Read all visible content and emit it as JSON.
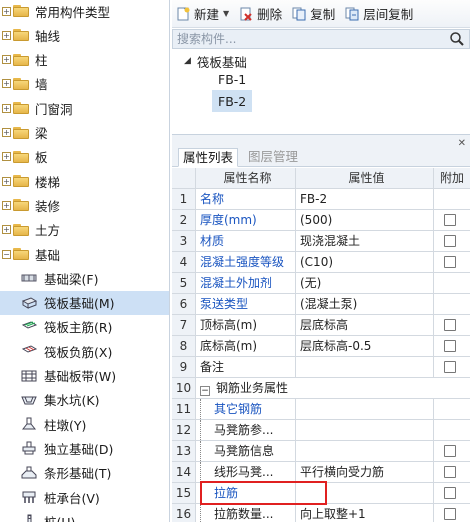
{
  "tree": {
    "categories": [
      {
        "label": "常用构件类型",
        "expanded": false
      },
      {
        "label": "轴线",
        "expanded": false
      },
      {
        "label": "柱",
        "expanded": false
      },
      {
        "label": "墙",
        "expanded": false
      },
      {
        "label": "门窗洞",
        "expanded": false
      },
      {
        "label": "梁",
        "expanded": false
      },
      {
        "label": "板",
        "expanded": false
      },
      {
        "label": "楼梯",
        "expanded": false
      },
      {
        "label": "装修",
        "expanded": false
      },
      {
        "label": "土方",
        "expanded": false
      },
      {
        "label": "基础",
        "expanded": true
      }
    ],
    "children": [
      {
        "label": "基础梁(F)",
        "icon": "foundation-beam-icon",
        "selected": false
      },
      {
        "label": "筏板基础(M)",
        "icon": "raft-foundation-icon",
        "selected": true
      },
      {
        "label": "筏板主筋(R)",
        "icon": "raft-main-rebar-icon",
        "selected": false
      },
      {
        "label": "筏板负筋(X)",
        "icon": "raft-negative-rebar-icon",
        "selected": false
      },
      {
        "label": "基础板带(W)",
        "icon": "foundation-strip-icon",
        "selected": false
      },
      {
        "label": "集水坑(K)",
        "icon": "sump-pit-icon",
        "selected": false
      },
      {
        "label": "柱墩(Y)",
        "icon": "column-pier-icon",
        "selected": false
      },
      {
        "label": "独立基础(D)",
        "icon": "isolated-footing-icon",
        "selected": false
      },
      {
        "label": "条形基础(T)",
        "icon": "strip-footing-icon",
        "selected": false
      },
      {
        "label": "桩承台(V)",
        "icon": "pile-cap-icon",
        "selected": false
      },
      {
        "label": "桩(U)",
        "icon": "pile-icon",
        "selected": false
      }
    ]
  },
  "toolbar": {
    "new_label": "新建",
    "delete_label": "删除",
    "copy_label": "复制",
    "floor_copy_label": "层间复制"
  },
  "search": {
    "placeholder": "搜索构件..."
  },
  "component_tree": {
    "group_label": "筏板基础",
    "items": [
      "FB-1",
      "FB-2"
    ],
    "selected": "FB-2"
  },
  "properties": {
    "tabs": [
      {
        "label": "属性列表",
        "active": true
      },
      {
        "label": "图层管理",
        "active": false
      }
    ],
    "headers": {
      "name": "属性名称",
      "value": "属性值",
      "add": "附加"
    },
    "rows": [
      {
        "num": "1",
        "name": "名称",
        "value": "FB-2",
        "blue": true,
        "check": false
      },
      {
        "num": "2",
        "name": "厚度(mm)",
        "value": "(500)",
        "blue": true,
        "check": true
      },
      {
        "num": "3",
        "name": "材质",
        "value": "现浇混凝土",
        "blue": true,
        "check": true
      },
      {
        "num": "4",
        "name": "混凝土强度等级",
        "value": "(C10)",
        "blue": true,
        "check": true
      },
      {
        "num": "5",
        "name": "混凝土外加剂",
        "value": "(无)",
        "blue": true,
        "check": false
      },
      {
        "num": "6",
        "name": "泵送类型",
        "value": "(混凝土泵)",
        "blue": true,
        "check": false
      },
      {
        "num": "7",
        "name": "顶标高(m)",
        "value": "层底标高",
        "blue": false,
        "check": true
      },
      {
        "num": "8",
        "name": "底标高(m)",
        "value": "层底标高-0.5",
        "blue": false,
        "check": true
      },
      {
        "num": "9",
        "name": "备注",
        "value": "",
        "blue": false,
        "check": true
      },
      {
        "num": "10",
        "name": "钢筋业务属性",
        "value": "",
        "blue": false,
        "check": false,
        "group": true
      },
      {
        "num": "11",
        "name": "其它钢筋",
        "value": "",
        "blue": true,
        "check": false,
        "child": true
      },
      {
        "num": "12",
        "name": "马凳筋参...",
        "value": "",
        "blue": false,
        "check": false,
        "child": true
      },
      {
        "num": "13",
        "name": "马凳筋信息",
        "value": "",
        "blue": false,
        "check": true,
        "child": true
      },
      {
        "num": "14",
        "name": "线形马凳...",
        "value": "平行横向受力筋",
        "blue": false,
        "check": true,
        "child": true
      },
      {
        "num": "15",
        "name": "拉筋",
        "value": "",
        "blue": true,
        "check": true,
        "child": true
      },
      {
        "num": "16",
        "name": "拉筋数量...",
        "value": "向上取整+1",
        "blue": false,
        "check": true,
        "child": true
      }
    ]
  }
}
